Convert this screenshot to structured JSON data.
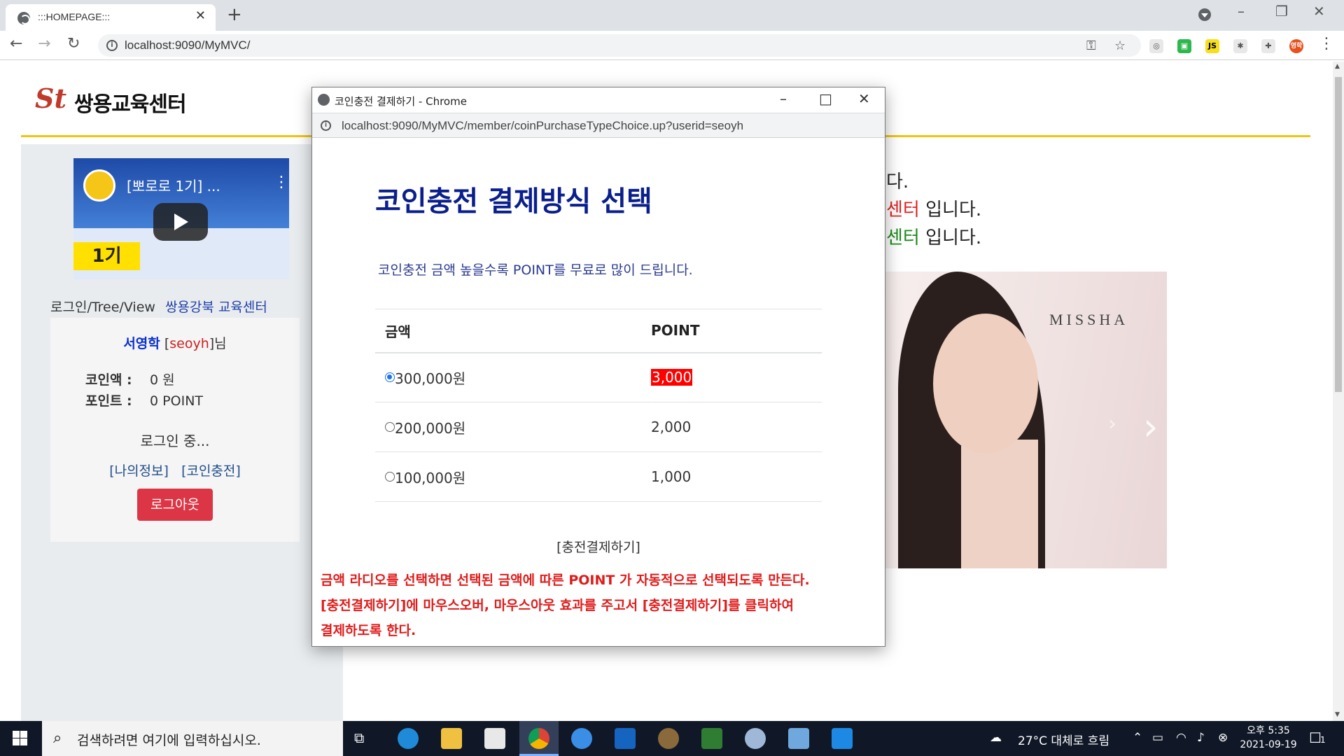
{
  "browser": {
    "tab_title": ":::HOMEPAGE:::",
    "url": "localhost:9090/MyMVC/"
  },
  "site": {
    "logo_text": "쌍용교육센터",
    "logo_mark": "St",
    "video_title": "[뽀로로 1기] ...",
    "video_label": "1기",
    "left_links": "로그인/Tree/View",
    "left_center": "쌍용강북 교육센터",
    "user_name": "서영학",
    "user_id": "seoyh",
    "coin_label": "코인액 :",
    "coin_value": "0 원",
    "point_label": "포인트 :",
    "point_value": "0 POINT",
    "login_status": "로그인 중...",
    "my_info": "[나의정보]",
    "coin_charge": "[코인충전]",
    "logout": "로그아웃",
    "right_line1": "다.",
    "right_line2_hl": "센터",
    "right_line2_rest": " 입니다.",
    "right_line3_hl": "센터",
    "right_line3_rest": " 입니다.",
    "ad_brand": "MISSHA"
  },
  "popup": {
    "title": "코인충전 결제하기 - Chrome",
    "url": "localhost:9090/MyMVC/member/coinPurchaseTypeChoice.up?userid=seoyh",
    "heading": "코인충전 결제방식 선택",
    "subtitle": "코인충전 금액 높을수록 POINT를 무료로 많이 드립니다.",
    "col_amount": "금액",
    "col_point": "POINT",
    "rows": [
      {
        "amount": "300,000원",
        "point": "3,000",
        "selected": true
      },
      {
        "amount": "200,000원",
        "point": "2,000",
        "selected": false
      },
      {
        "amount": "100,000원",
        "point": "1,000",
        "selected": false
      }
    ],
    "submit": "[충전결제하기]",
    "note1": "금액 라디오를 선택하면 선택된 금액에 따른 POINT 가 자동적으로 선택되도록 만든다.",
    "note2": "[충전결제하기]에 마우스오버, 마우스아웃 효과를 주고서 [충전결제하기]를 클릭하여",
    "note3": "결제하도록 한다."
  },
  "taskbar": {
    "search_placeholder": "검색하려면 여기에 입력하십시오.",
    "weather": "27°C  대체로 흐림",
    "time": "오후 5:35",
    "date": "2021-09-19",
    "profile_badge": "영학",
    "notif_count": "1"
  },
  "colors": {
    "accent_yellow": "#f1c40f",
    "logout_red": "#dc3545",
    "heading_navy": "#0a1f8c",
    "note_red": "#e01b1b"
  }
}
